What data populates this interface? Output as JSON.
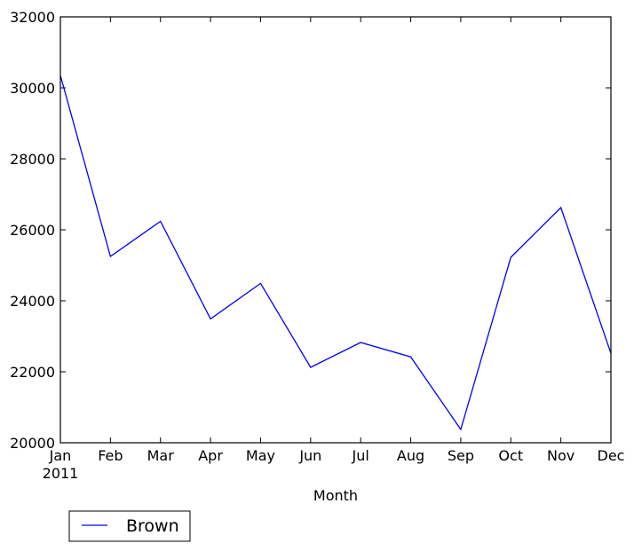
{
  "chart_data": {
    "type": "line",
    "title": "",
    "xlabel": "Month",
    "ylabel": "",
    "categories": [
      "Jan",
      "Feb",
      "Mar",
      "Apr",
      "May",
      "Jun",
      "Jul",
      "Aug",
      "Sep",
      "Oct",
      "Nov",
      "Dec"
    ],
    "x_sublabel": "2011",
    "ylim": [
      20000,
      32000
    ],
    "yticks": [
      20000,
      22000,
      24000,
      26000,
      28000,
      30000,
      32000
    ],
    "ytick_labels": [
      "20000",
      "22000",
      "24000",
      "26000",
      "28000",
      "30000",
      "32000"
    ],
    "grid": false,
    "legend_position": "bottom-left, below axes",
    "series": [
      {
        "name": "Brown",
        "color": "#0000ff",
        "values": [
          30350,
          25250,
          26240,
          23490,
          24490,
          22125,
          22825,
          22420,
          20375,
          25225,
          26625,
          22520
        ]
      }
    ]
  }
}
